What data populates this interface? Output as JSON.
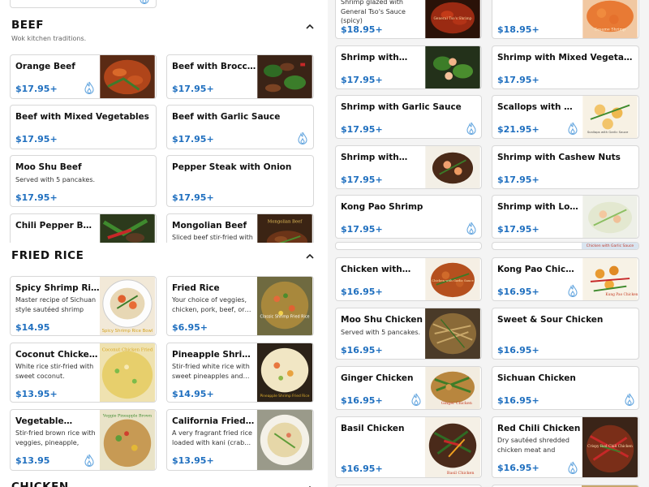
{
  "accent_color": "#1f6fbf",
  "sections": {
    "beef": {
      "title": "BEEF",
      "subtitle": "Wok kitchen traditions."
    },
    "fried_rice": {
      "title": "FRIED RICE"
    },
    "chicken": {
      "title": "CHICKEN"
    }
  },
  "left_items": [
    {
      "name": "Orange Beef",
      "price": "$17.95+",
      "spicy": true,
      "image": "dish-photo"
    },
    {
      "name": "Beef with Broccoli",
      "price": "$17.95+",
      "spicy": false,
      "image": "dish-photo"
    },
    {
      "name": "Beef with Mixed Vegetables",
      "price": "$17.95+",
      "spicy": false
    },
    {
      "name": "Beef with Garlic Sauce",
      "price": "$17.95+",
      "spicy": true
    },
    {
      "name": "Moo Shu Beef",
      "desc": "Served with 5 pancakes.",
      "price": "$17.95+",
      "spicy": false
    },
    {
      "name": "Pepper Steak with Onion",
      "price": "$17.95+",
      "spicy": false
    },
    {
      "name": "Chili Pepper Beef",
      "price": "",
      "image": "dish-photo"
    },
    {
      "name": "Mongolian Beef",
      "desc": "Sliced beef stir-fried with",
      "price": "",
      "image": "dish-photo",
      "image_caption": "Mongolian Beef"
    },
    {
      "name": "Spicy Shrimp Rice…",
      "desc": "Master recipe of Sichuan style sautéed shrimp wit…",
      "price": "$14.95",
      "image": "dish-photo",
      "image_caption": "Spicy Shrimp Rice Bowl"
    },
    {
      "name": "Fried Rice",
      "desc": "Your choice of veggies, chicken, pork, beef, or…",
      "price": "$6.95+",
      "image": "dish-photo",
      "image_caption": "Classic Shrimp Fried Rice"
    },
    {
      "name": "Coconut Chicken…",
      "desc": "White rice stir-fried with sweet coconut.",
      "price": "$13.95+",
      "image": "dish-photo",
      "image_caption": "Coconut Chicken Fried"
    },
    {
      "name": "Pineapple Shrimp…",
      "desc": "Stir-fried white rice with sweet pineapples and…",
      "price": "$14.95+",
      "image": "dish-photo",
      "image_caption": "Pineapple Shrimp Fried Rice"
    },
    {
      "name": "Vegetable…",
      "desc": "Stir-fried brown rice with veggies, pineapple, cash…",
      "price": "$13.95",
      "spicy": true,
      "image": "dish-photo",
      "image_caption": "Veggie Pineapple Brown"
    },
    {
      "name": "California Fried Rice",
      "desc": "A very fragrant fried rice loaded with kani (crab…",
      "price": "$13.95+",
      "image": "dish-photo"
    }
  ],
  "right_items": [
    {
      "name": "",
      "desc": "Shrimp glazed with General Tso's Sauce (spicy)",
      "price": "$18.95+",
      "image": "dish-photo",
      "image_caption": "General Tso's Shrimp"
    },
    {
      "name": "",
      "price": "$18.95+",
      "image": "dish-photo",
      "image_caption": "Sesame Shrimp"
    },
    {
      "name": "Shrimp with…",
      "price": "$17.95+",
      "image": "dish-photo"
    },
    {
      "name": "Shrimp with Mixed Vegetables",
      "price": "$17.95+"
    },
    {
      "name": "Shrimp with Garlic Sauce",
      "price": "$17.95+",
      "spicy": true
    },
    {
      "name": "Scallops with Garli…",
      "price": "$21.95+",
      "spicy": true,
      "image": "dish-photo",
      "image_caption": "Scallops with Garlic Sauce"
    },
    {
      "name": "Shrimp with…",
      "price": "$17.95+",
      "image": "dish-photo"
    },
    {
      "name": "Shrimp with Cashew Nuts",
      "price": "$17.95+"
    },
    {
      "name": "Kong Pao Shrimp",
      "price": "$17.95+",
      "spicy": true
    },
    {
      "name": "Shrimp with Lobst…",
      "price": "$17.95+",
      "image": "dish-photo"
    },
    {
      "name": "Chicken with…",
      "price": "$16.95+",
      "image": "dish-photo",
      "image_caption": "Chicken with Garlic Sauce"
    },
    {
      "name": "Kong Pao Chicken",
      "price": "$16.95+",
      "spicy": true,
      "image": "dish-photo",
      "image_caption": "Kung Pao Chicken"
    },
    {
      "name": "Moo Shu Chicken",
      "desc": "Served with 5 pancakes.",
      "price": "$16.95+",
      "image": "dish-photo"
    },
    {
      "name": "Sweet & Sour Chicken",
      "price": "$16.95+"
    },
    {
      "name": "Ginger Chicken",
      "price": "$16.95+",
      "spicy": true,
      "image": "dish-photo",
      "image_caption": "Ginger Chicken"
    },
    {
      "name": "Sichuan Chicken",
      "price": "$16.95+",
      "spicy": true
    },
    {
      "name": "Basil Chicken",
      "price": "$16.95+",
      "image": "dish-photo",
      "image_caption": "Basil Chicken"
    },
    {
      "name": "Red Chili Chicken",
      "desc": "Dry sautéed shredded chicken meat and string…",
      "price": "$16.95+",
      "spicy": true,
      "image": "dish-photo",
      "image_caption": "Crispy Red Chili Chicken"
    }
  ],
  "partial_captions": {
    "chicken_garlic_sauce": "Chicken with Garlic Sauce"
  }
}
